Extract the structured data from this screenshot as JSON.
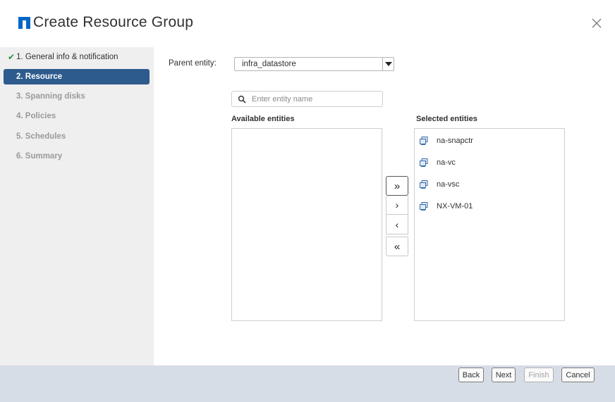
{
  "dialog": {
    "title": "Create Resource Group"
  },
  "sidebar": {
    "steps": [
      {
        "label": "1. General info & notification",
        "state": "done"
      },
      {
        "label": "2. Resource",
        "state": "active"
      },
      {
        "label": "3. Spanning disks",
        "state": "inactive"
      },
      {
        "label": "4. Policies",
        "state": "inactive"
      },
      {
        "label": "5. Schedules",
        "state": "inactive"
      },
      {
        "label": "6. Summary",
        "state": "inactive"
      }
    ]
  },
  "resource": {
    "parent_label": "Parent entity:",
    "parent_value": "infra_datastore",
    "search_placeholder": "Enter entity name",
    "available_label": "Available entities",
    "selected_label": "Selected entities",
    "available": [],
    "selected": [
      "na-snapctr",
      "na-vc",
      "na-vsc",
      "NX-VM-01"
    ],
    "movers": {
      "add_all": "»",
      "add": "›",
      "remove": "‹",
      "remove_all": "«"
    }
  },
  "footer": {
    "back": "Back",
    "next": "Next",
    "finish": "Finish",
    "cancel": "Cancel"
  },
  "colors": {
    "accent": "#2d5b8d",
    "logo": "#0067c5",
    "check": "#2e8b3a",
    "footer_bg": "#d7dde7",
    "sidebar_bg": "#efefef"
  }
}
